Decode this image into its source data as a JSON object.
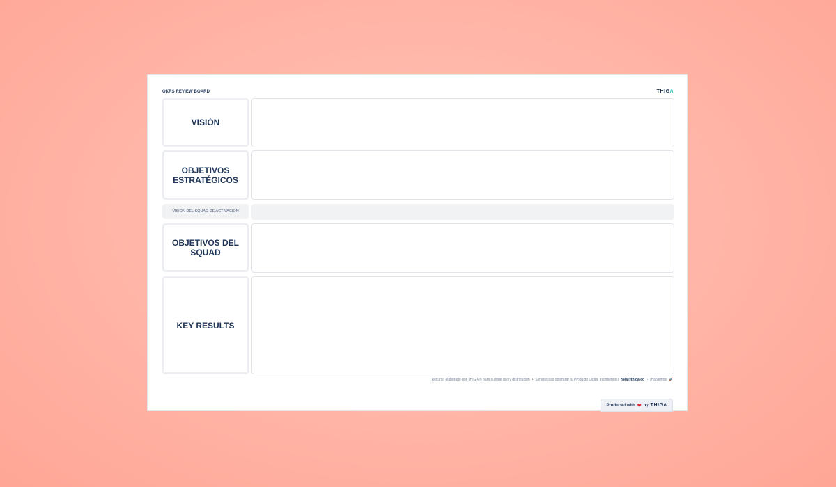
{
  "board": {
    "title": "OKRS REVIEW BOARD",
    "brand_main": "THIG",
    "brand_accent": "Λ"
  },
  "rows": {
    "vision": "VISIÓN",
    "strategic": "OBJETIVOS ESTRATÉGICOS",
    "squad_vision": "VISIÓN DEL SQUAD DE ACTIVACIÓN",
    "squad_objectives": "OBJETIVOS DEL SQUAD",
    "key_results": "KEY RESULTS"
  },
  "footer": {
    "text1": "Recurso elaborado por THIGA ® para su libre uso y distribución",
    "text2": "Si necesitas optimizar tu Producto Digital escríbenos a",
    "email": "hola@thiga.co",
    "text3": "¡Hablemos!",
    "rocket": "🚀"
  },
  "badge": {
    "produced": "Produced with",
    "heart": "❤",
    "by": "by",
    "brand": "THIGΛ"
  },
  "colors": {
    "background": "#ffb7a9",
    "navy": "#1e3557",
    "accent": "#20c3b8"
  }
}
